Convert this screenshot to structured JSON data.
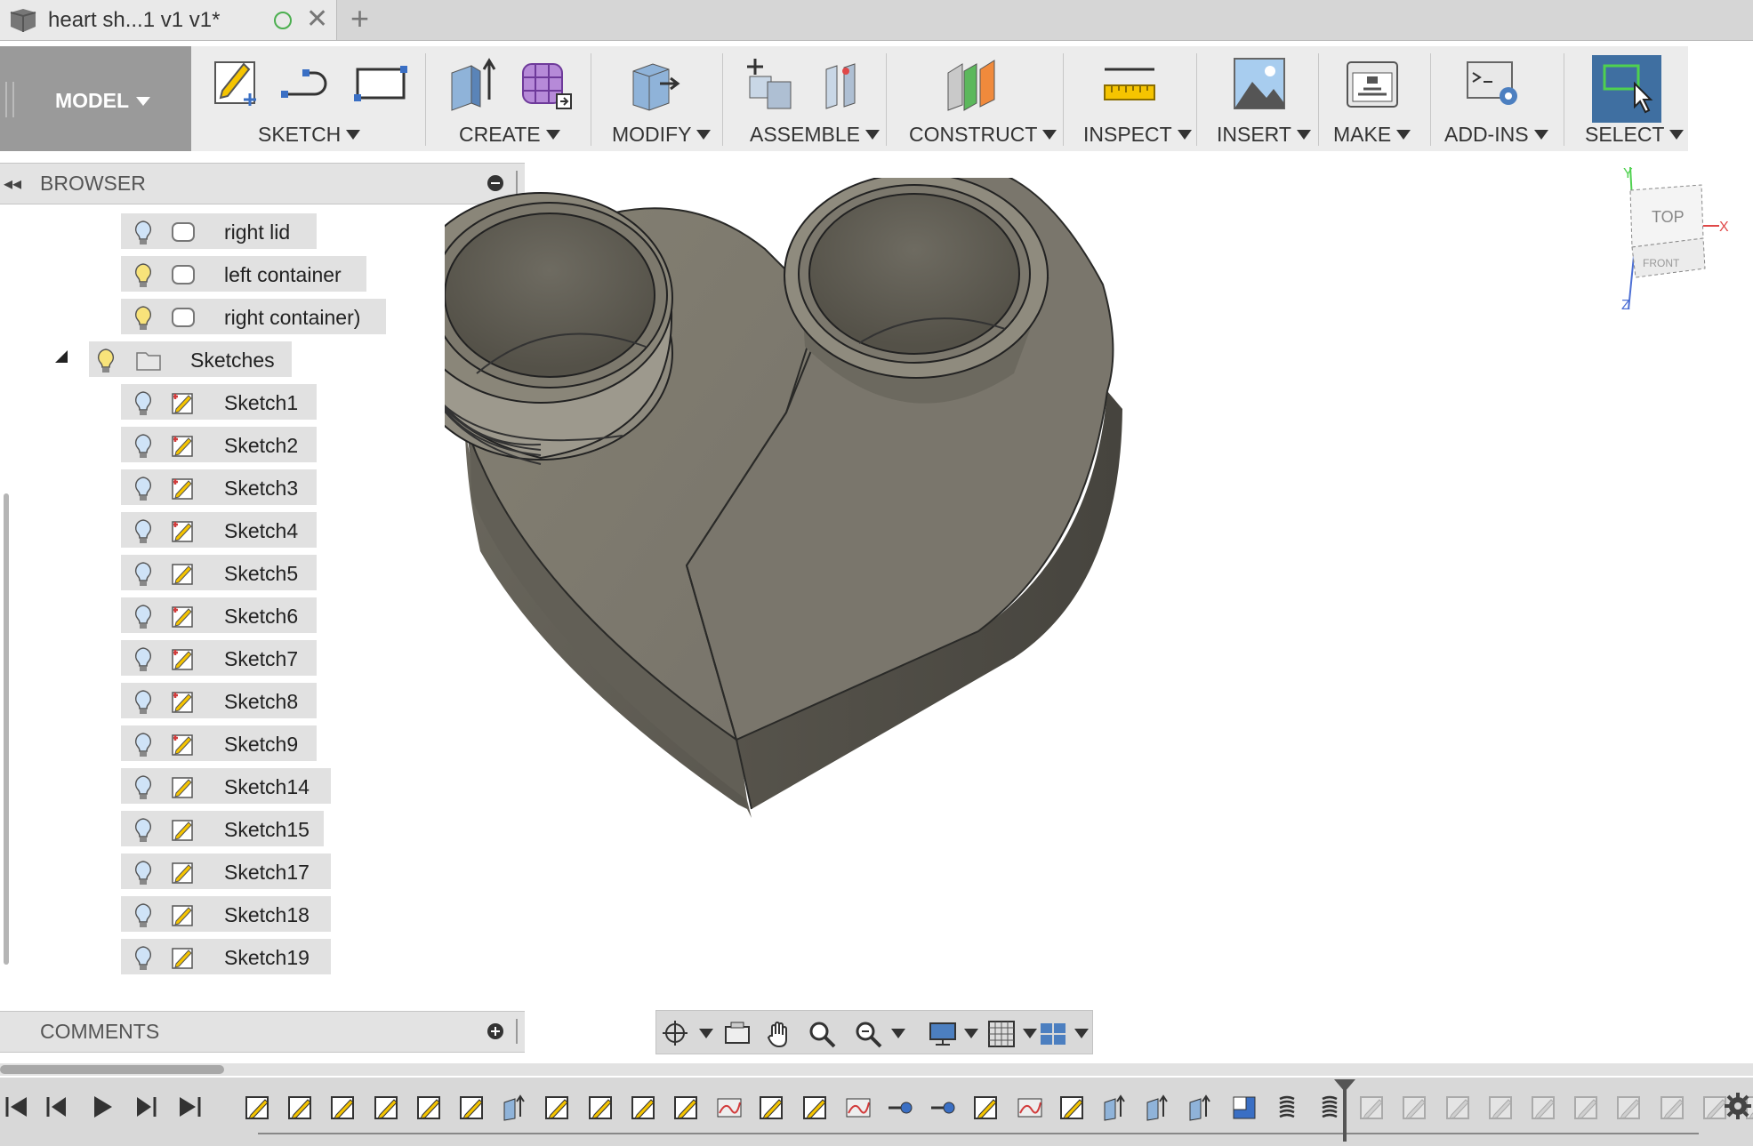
{
  "tab": {
    "title": "heart sh...1 v1 v1*"
  },
  "workspace": {
    "label": "MODEL"
  },
  "toolbar": {
    "groups": [
      "SKETCH",
      "CREATE",
      "MODIFY",
      "ASSEMBLE",
      "CONSTRUCT",
      "INSPECT",
      "INSERT",
      "MAKE",
      "ADD-INS",
      "SELECT"
    ]
  },
  "browser": {
    "title": "BROWSER",
    "items": [
      "right lid",
      "left container",
      "right container)"
    ],
    "sketches_folder": "Sketches",
    "sketches": [
      "Sketch1",
      "Sketch2",
      "Sketch3",
      "Sketch4",
      "Sketch5",
      "Sketch6",
      "Sketch7",
      "Sketch8",
      "Sketch9",
      "Sketch14",
      "Sketch15",
      "Sketch17",
      "Sketch18",
      "Sketch19"
    ]
  },
  "comments": {
    "title": "COMMENTS"
  },
  "viewcube": {
    "top": "TOP",
    "front": "FRONT",
    "x": "X",
    "y": "Y",
    "z": "Z"
  },
  "colors": {
    "toolbar_bg": "#ececec",
    "model_bg": "#9a9a9a",
    "select_active": "#3f6fa1",
    "sketch_accent": "#f5c400",
    "body_color": "#7a766a"
  }
}
